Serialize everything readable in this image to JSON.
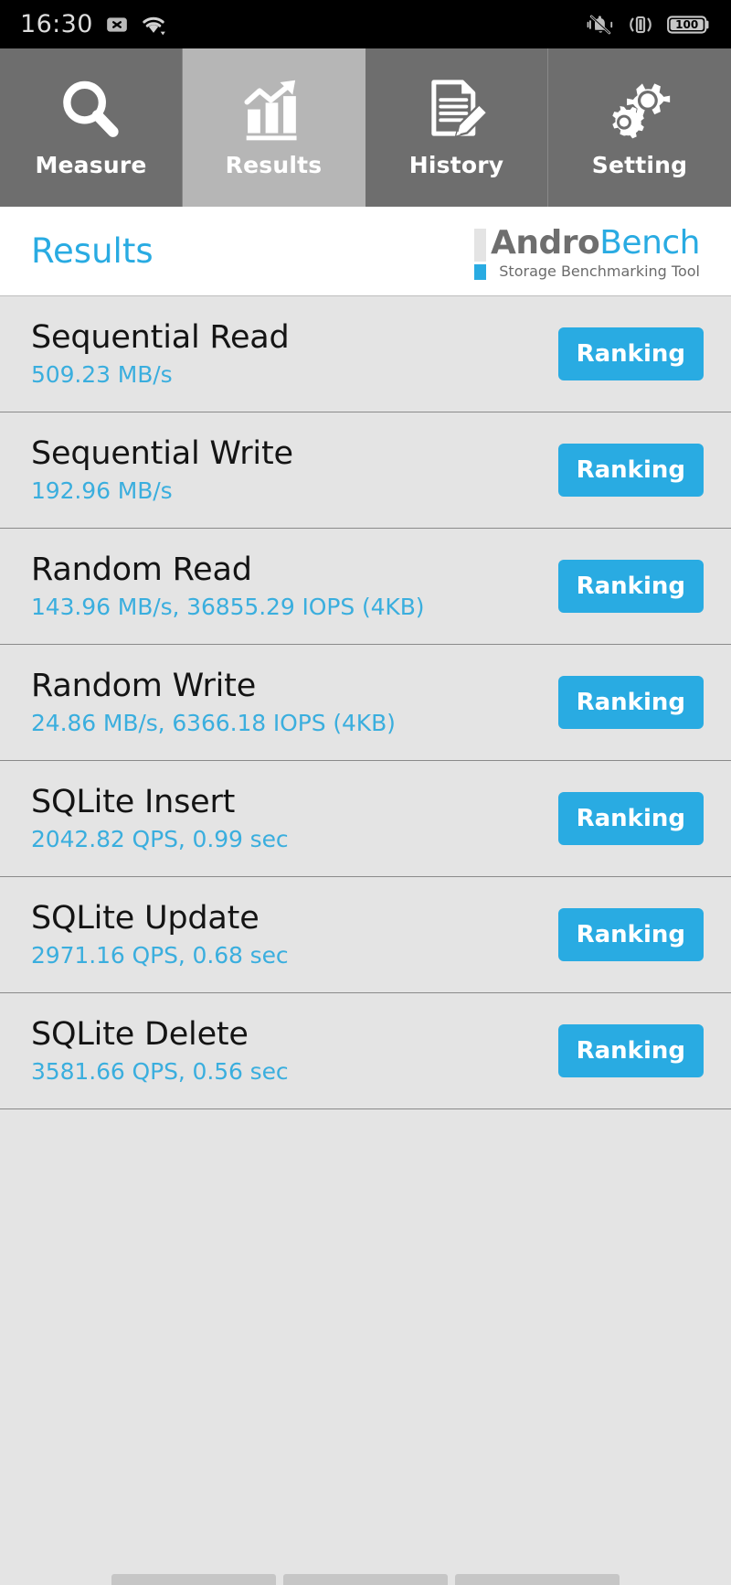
{
  "statusbar": {
    "time": "16:30",
    "battery_level": "100",
    "icons": {
      "sdcard_removed": "sdcard-off-icon",
      "wifi": "wifi-icon",
      "silent": "bell-muted-icon",
      "vibrate": "vibrate-icon",
      "battery": "battery-icon"
    }
  },
  "tabs": [
    {
      "label": "Measure",
      "icon": "magnifier-icon",
      "selected": false
    },
    {
      "label": "Results",
      "icon": "bar-chart-arrow-icon",
      "selected": true
    },
    {
      "label": "History",
      "icon": "document-pencil-icon",
      "selected": false
    },
    {
      "label": "Setting",
      "icon": "gears-icon",
      "selected": false
    }
  ],
  "header": {
    "title": "Results",
    "logo_part1": "Andro",
    "logo_part2": "Bench",
    "logo_subtitle": "Storage Benchmarking Tool"
  },
  "results": [
    {
      "title": "Sequential Read",
      "value": "509.23 MB/s",
      "button": "Ranking"
    },
    {
      "title": "Sequential Write",
      "value": "192.96 MB/s",
      "button": "Ranking"
    },
    {
      "title": "Random Read",
      "value": "143.96 MB/s, 36855.29 IOPS (4KB)",
      "button": "Ranking"
    },
    {
      "title": "Random Write",
      "value": "24.86 MB/s, 6366.18 IOPS (4KB)",
      "button": "Ranking"
    },
    {
      "title": "SQLite Insert",
      "value": "2042.82 QPS, 0.99 sec",
      "button": "Ranking"
    },
    {
      "title": "SQLite Update",
      "value": "2971.16 QPS, 0.68 sec",
      "button": "Ranking"
    },
    {
      "title": "SQLite Delete",
      "value": "3581.66 QPS, 0.56 sec",
      "button": "Ranking"
    }
  ],
  "colors": {
    "accent_blue": "#29abe2",
    "value_blue": "#3aaede",
    "tab_unselected": "#6e6e6e",
    "tab_selected": "#b6b6b6",
    "list_background": "#e4e4e4",
    "statusbar_background": "#000000"
  }
}
